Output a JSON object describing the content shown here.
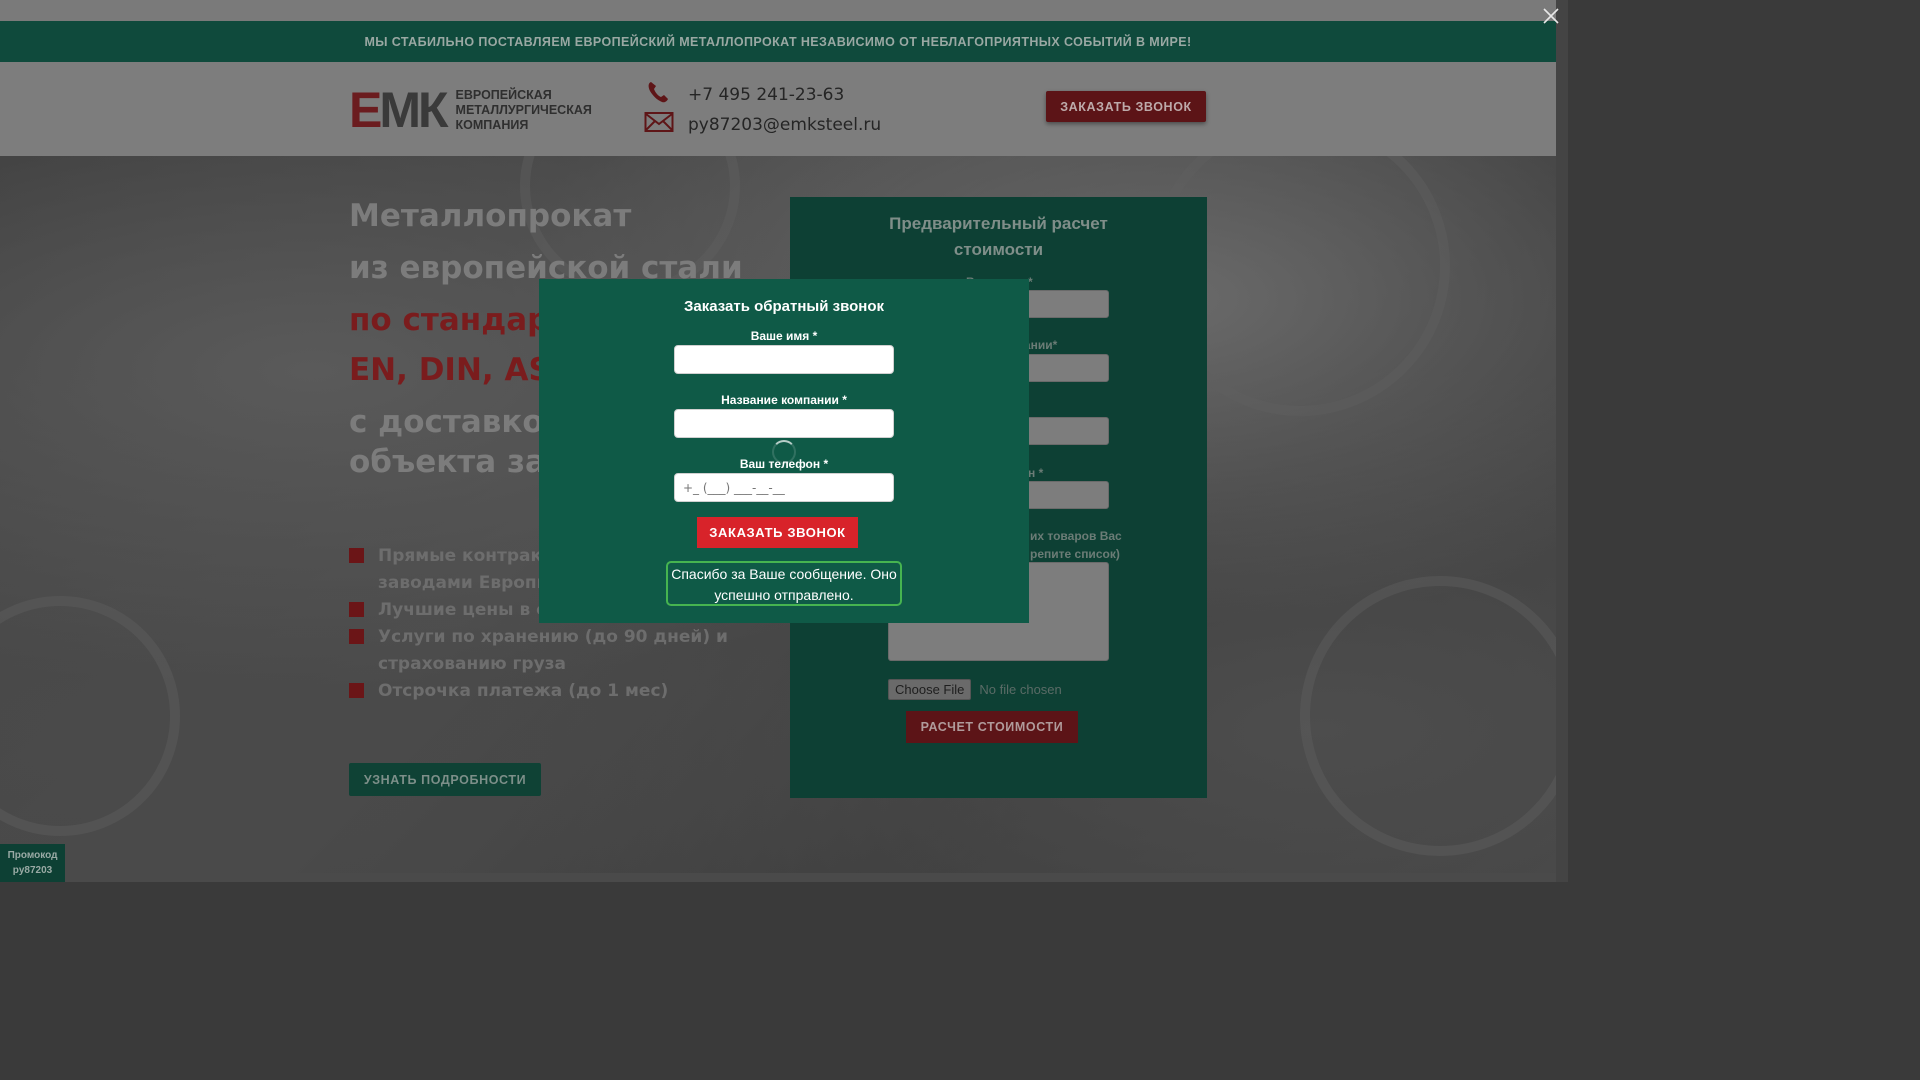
{
  "banner": {
    "text": "МЫ СТАБИЛЬНО ПОСТАВЛЯЕМ ЕВРОПЕЙСКИЙ МЕТАЛЛОПРОКАТ НЕЗАВИСИМО ОТ НЕБЛАГОПРИЯТНЫХ СОБЫТИЙ В МИРЕ!"
  },
  "header": {
    "logo_mark": "ЕМК",
    "logo_lines": [
      "ЕВРОПЕЙСКАЯ",
      "МЕТАЛЛУРГИЧЕСКАЯ",
      "КОМПАНИЯ"
    ],
    "phone": "+7 495 241-23-63",
    "email": "py87203@emksteel.ru",
    "callback_button": "ЗАКАЗАТЬ ЗВОНОК"
  },
  "hero": {
    "line1": "Металлопрокат",
    "line2": "из европейской стали",
    "line3": "по стандарта",
    "line4": "EN, DIN, ASM",
    "line5": "с доставкой",
    "line6": "объекта зака",
    "bullets": [
      {
        "text": "Прямые контракты",
        "text2": "заводами Европы"
      },
      {
        "text": "Лучшие цены в сво"
      },
      {
        "text": "Услуги по хранению (до 90 дней) и",
        "text2": "страхованию груза"
      },
      {
        "text": "Отсрочка платежа (до 1 мес)"
      }
    ],
    "more_button": "УЗНАТЬ ПОДРОБНОСТИ"
  },
  "calc_form": {
    "title_line1": "Предварительный расчет",
    "title_line2": "стоимости",
    "label_name": "Ваше имя *",
    "label_company": "анании*",
    "label_email": "*",
    "label_phone": "н *",
    "label_list_line1": "их товаров Вас",
    "label_list_line2": "репите список)",
    "file_button": "Choose File",
    "file_status": "No file chosen",
    "submit": "РАСЧЕТ СТОИМОСТИ"
  },
  "promo": {
    "line1": "Промокод",
    "line2": "py87203"
  },
  "modal": {
    "title": "Заказать обратный звонок",
    "label_name": "Ваше имя *",
    "label_company": "Название компании *",
    "label_phone": "Ваш телефон *",
    "phone_placeholder": "+_ (___) ___-__-__",
    "submit": "ЗАКАЗАТЬ ЗВОНОК",
    "success_line1": "Спасибо за Ваше сообщение. Оно",
    "success_line2": "успешно отправлено."
  },
  "colors": {
    "brand_green": "#0f5a47",
    "brand_red": "#d8232a",
    "success_border": "#46b450"
  },
  "icons": {
    "phone": "phone-icon",
    "mail": "mail-icon",
    "close": "close-icon"
  }
}
